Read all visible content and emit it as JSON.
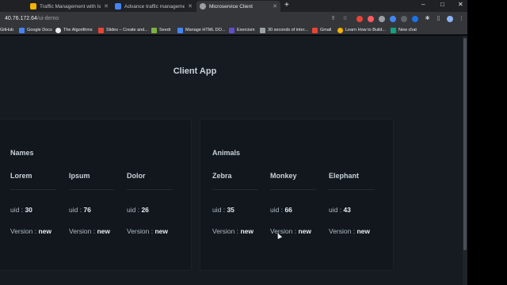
{
  "browser": {
    "tabs": [
      {
        "title": "Traffic Management with Istio - G",
        "favicon_color": "#f4b400",
        "active": false
      },
      {
        "title": "Advance traffic management",
        "favicon_color": "#4285f4",
        "active": false
      },
      {
        "title": "Microservice Client",
        "favicon_color": "#9aa0a6",
        "active": true
      }
    ],
    "new_tab_label": "+",
    "window_controls": {
      "minimize": "–",
      "maximize": "□",
      "close": "✕"
    },
    "tab_close": "✕",
    "address": {
      "host": "40.76.172.64",
      "path": "/ui-demo"
    },
    "toolbar_icons": [
      "share-icon",
      "star-icon",
      "extensions-icon",
      "profile-icon",
      "menu-icon"
    ],
    "bookmarks": [
      {
        "label": "GitHub",
        "color": "#e8eaed"
      },
      {
        "label": "Google Docs",
        "color": "#4285f4"
      },
      {
        "label": "The Algorithms",
        "color": "#e8eaed"
      },
      {
        "label": "Slides – Create and...",
        "color": "#f4b400"
      },
      {
        "label": "Seedr",
        "color": "#e8eaed"
      },
      {
        "label": "Manage HTML DO...",
        "color": "#4285f4"
      },
      {
        "label": "Exercism",
        "color": "#604fcd"
      },
      {
        "label": "30 seconds of inter...",
        "color": "#9aa0a6"
      },
      {
        "label": "Gmail",
        "color": "#ea4335"
      },
      {
        "label": "Learn How to Build...",
        "color": "#f4b400"
      },
      {
        "label": "New chat",
        "color": "#10a37f"
      }
    ]
  },
  "page": {
    "title": "Client App",
    "cards": [
      {
        "heading": "Names",
        "items": [
          {
            "name": "Lorem",
            "uid": "30",
            "version": "new"
          },
          {
            "name": "Ipsum",
            "uid": "76",
            "version": "new"
          },
          {
            "name": "Dolor",
            "uid": "26",
            "version": "new"
          }
        ]
      },
      {
        "heading": "Animals",
        "items": [
          {
            "name": "Zebra",
            "uid": "35",
            "version": "new"
          },
          {
            "name": "Monkey",
            "uid": "66",
            "version": "new"
          },
          {
            "name": "Elephant",
            "uid": "43",
            "version": "new"
          }
        ]
      }
    ],
    "uid_label": "uid : ",
    "version_label": "Version : "
  },
  "colors": {
    "page_background": "#161b22",
    "card_background": "#11171c",
    "text": "#c9d1d9"
  }
}
